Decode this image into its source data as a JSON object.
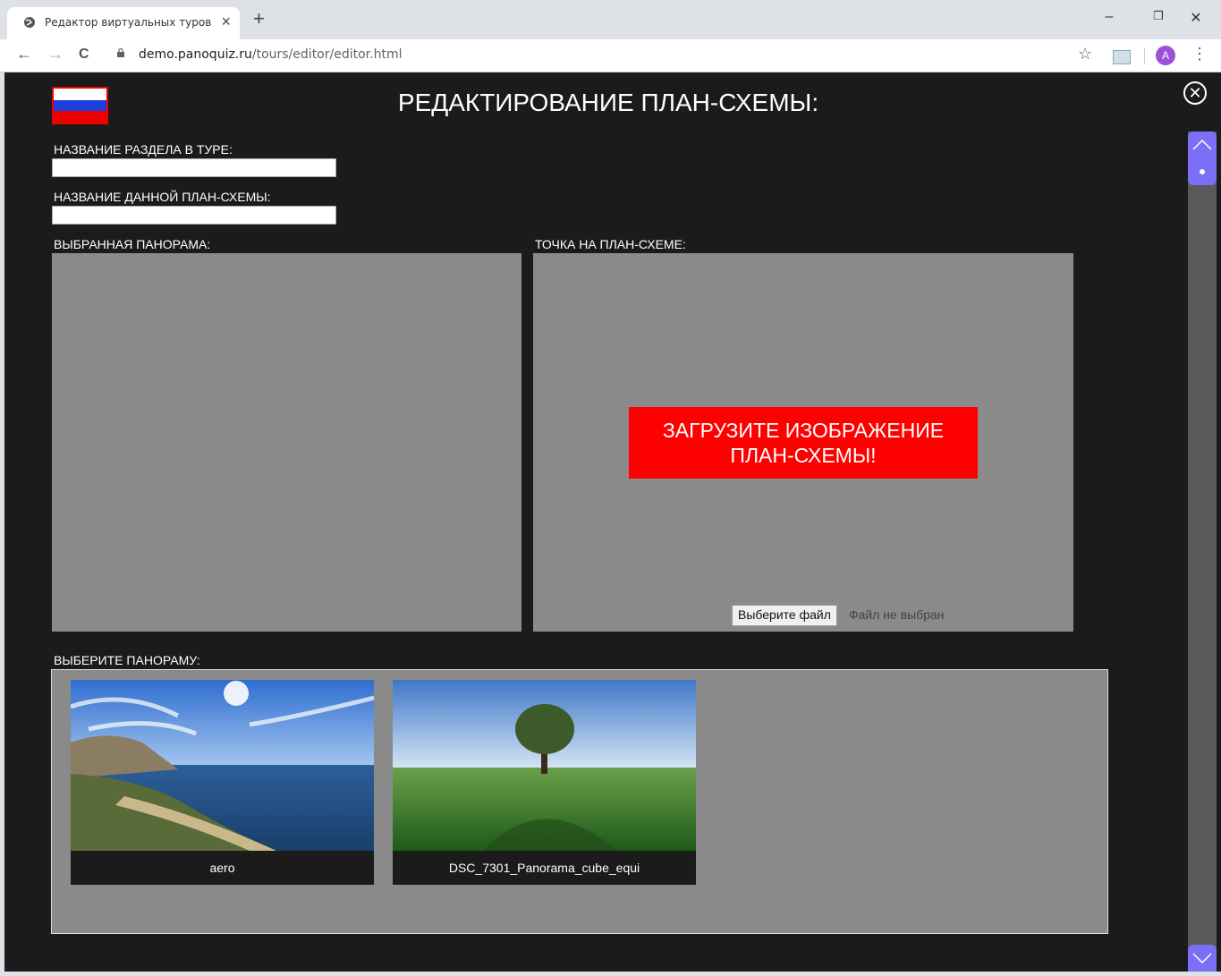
{
  "browser": {
    "tab_title": "Редактор виртуальных туров",
    "tab_close": "×",
    "new_tab": "+",
    "url_host": "demo.panoquiz.ru",
    "url_path": "/tours/editor/editor.html",
    "avatar_letter": "A",
    "minimize": "–",
    "restore": "❐",
    "close": "✕",
    "back": "←",
    "forward": "→",
    "reload": "C",
    "star": "☆",
    "menu": "⋮"
  },
  "page": {
    "title": "РЕДАКТИРОВАНИЕ ПЛАН-СХЕМЫ:",
    "close_symbol": "✕",
    "section_name_label": "НАЗВАНИЕ РАЗДЕЛА В ТУРЕ:",
    "section_name_value": "",
    "plan_name_label": "НАЗВАНИЕ ДАННОЙ ПЛАН-СХЕМЫ:",
    "plan_name_value": "",
    "selected_panorama_label": "ВЫБРАННАЯ ПАНОРАМА:",
    "plan_point_label": "ТОЧКА НА ПЛАН-СХЕМЕ:",
    "upload_message_line1": "ЗАГРУЗИТЕ ИЗОБРАЖЕНИЕ",
    "upload_message_line2": "ПЛАН-СХЕМЫ!",
    "file_button": "Выберите файл",
    "file_status": "Файл не выбран",
    "choose_panorama_label": "ВЫБЕРИТЕ ПАНОРАМУ:",
    "panoramas": [
      {
        "name": "aero"
      },
      {
        "name": "DSC_7301_Panorama_cube_equi"
      }
    ]
  },
  "colors": {
    "background": "#1b1b1b",
    "panel": "#8a8a8a",
    "alert": "#ff0000",
    "scroll_accent": "#7b6ff5"
  }
}
